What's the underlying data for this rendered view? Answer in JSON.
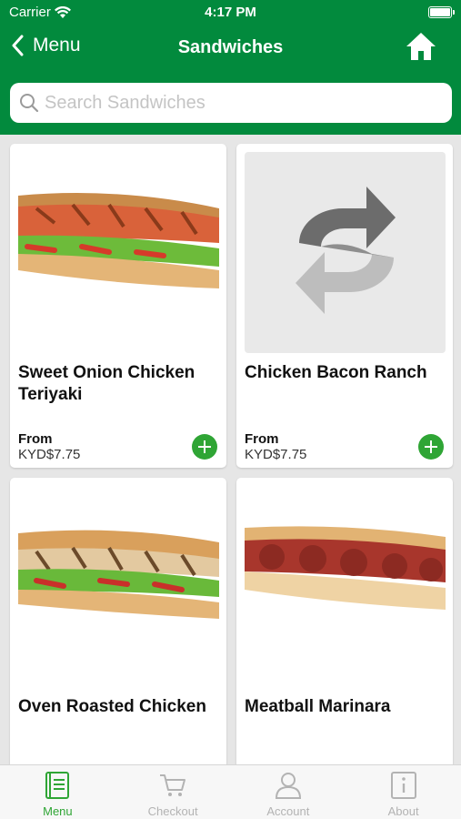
{
  "status_bar": {
    "carrier": "Carrier",
    "time": "4:17 PM"
  },
  "nav": {
    "back_label": "Menu",
    "title": "Sandwiches"
  },
  "search": {
    "placeholder": "Search Sandwiches",
    "value": ""
  },
  "items": [
    {
      "name": "Sweet Onion Chicken Teriyaki",
      "from_label": "From",
      "price": "KYD$7.75",
      "image": "sweet-onion-chicken-teriyaki-sub"
    },
    {
      "name": "Chicken Bacon Ranch",
      "from_label": "From",
      "price": "KYD$7.75",
      "image": "subway-placeholder-logo"
    },
    {
      "name": "Oven Roasted Chicken",
      "image": "oven-roasted-chicken-sub"
    },
    {
      "name": "Meatball Marinara",
      "image": "meatball-marinara-sub"
    }
  ],
  "tabs": [
    {
      "label": "Menu",
      "icon": "menu-book-icon",
      "active": true
    },
    {
      "label": "Checkout",
      "icon": "cart-icon",
      "active": false
    },
    {
      "label": "Account",
      "icon": "person-icon",
      "active": false
    },
    {
      "label": "About",
      "icon": "info-icon",
      "active": false
    }
  ],
  "colors": {
    "header_green": "#028a3d",
    "accent_green": "#2fa535",
    "inactive_tab": "#b3b3b3"
  }
}
